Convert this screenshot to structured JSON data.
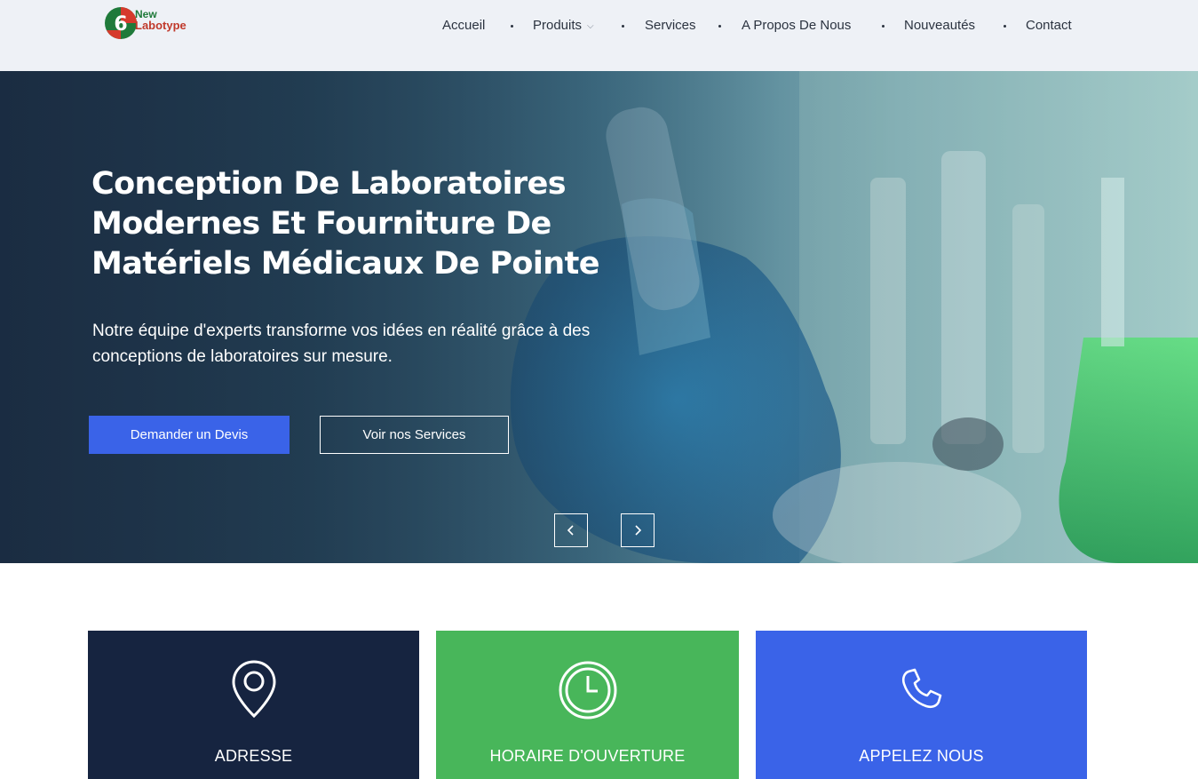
{
  "header": {
    "logo": {
      "line1": "New",
      "line2": "Labotype",
      "colors": {
        "green": "#1f7a3a",
        "red": "#c0392b"
      }
    },
    "nav": [
      {
        "label": "Accueil"
      },
      {
        "label": "Produits",
        "has_dropdown": true,
        "icon": "chevron-down-icon"
      },
      {
        "label": "Services"
      },
      {
        "label": "A Propos De Nous"
      },
      {
        "label": "Nouveautés"
      },
      {
        "label": "Contact"
      }
    ]
  },
  "hero": {
    "title": "Conception De Laboratoires Modernes Et Fourniture De Matériels Médicaux De Pointe",
    "subtitle": "Notre équipe d'experts transforme vos idées en réalité grâce à des conceptions de laboratoires sur mesure.",
    "primary_button": "Demander un Devis",
    "secondary_button": "Voir nos Services",
    "prev_icon": "chevron-left-icon",
    "next_icon": "chevron-right-icon"
  },
  "cards": [
    {
      "title": "ADRESSE",
      "icon": "map-pin-icon",
      "color": "#162440"
    },
    {
      "title": "HORAIRE D'OUVERTURE",
      "icon": "clock-icon",
      "color": "#48b65a"
    },
    {
      "title": "APPELEZ NOUS",
      "icon": "phone-icon",
      "color": "#3a63e8"
    }
  ],
  "colors": {
    "accent_blue": "#3a63e8",
    "navy": "#162440",
    "green": "#48b65a",
    "header_bg": "#eef1f6"
  }
}
